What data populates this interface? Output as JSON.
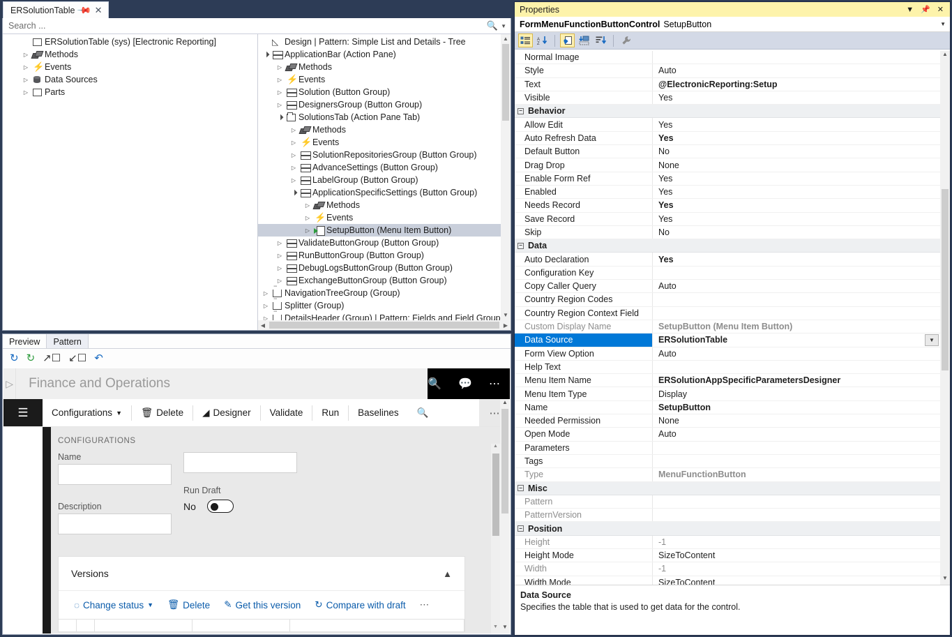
{
  "window": {
    "background": "#2d3c56"
  },
  "document_tab": {
    "label": "ERSolutionTable",
    "pin_icon": "pin-icon",
    "close_icon": "close-icon"
  },
  "search": {
    "placeholder": "Search ...",
    "icon": "search-icon",
    "dropdown_icon": "chevron-down-icon"
  },
  "model_tree": {
    "nodes": [
      {
        "label": "ERSolutionTable (sys) [Electronic Reporting]",
        "icon": "form-icon",
        "indent": 1,
        "arrow": "none"
      },
      {
        "label": "Methods",
        "icon": "methods-icon",
        "indent": 1,
        "arrow": "closed"
      },
      {
        "label": "Events",
        "icon": "event-icon",
        "indent": 1,
        "arrow": "closed"
      },
      {
        "label": "Data Sources",
        "icon": "datasource-icon",
        "indent": 1,
        "arrow": "closed"
      },
      {
        "label": "Parts",
        "icon": "form-icon",
        "indent": 1,
        "arrow": "closed"
      }
    ]
  },
  "design_tree": {
    "nodes": [
      {
        "label": "Design | Pattern: Simple List and Details - Tree",
        "icon": "design-icon",
        "indent": 0,
        "arrow": "none",
        "selected": false
      },
      {
        "label": "ApplicationBar (Action Pane)",
        "icon": "btngroup-icon",
        "indent": 0,
        "arrow": "open",
        "selected": false
      },
      {
        "label": "Methods",
        "icon": "methods-icon",
        "indent": 1,
        "arrow": "closed",
        "selected": false
      },
      {
        "label": "Events",
        "icon": "event-icon",
        "indent": 1,
        "arrow": "closed",
        "selected": false
      },
      {
        "label": "Solution (Button Group)",
        "icon": "btngroup-icon",
        "indent": 1,
        "arrow": "closed",
        "selected": false
      },
      {
        "label": "DesignersGroup (Button Group)",
        "icon": "btngroup-icon",
        "indent": 1,
        "arrow": "closed",
        "selected": false
      },
      {
        "label": "SolutionsTab (Action Pane Tab)",
        "icon": "tab-icon",
        "indent": 1,
        "arrow": "open",
        "selected": false
      },
      {
        "label": "Methods",
        "icon": "methods-icon",
        "indent": 2,
        "arrow": "closed",
        "selected": false
      },
      {
        "label": "Events",
        "icon": "event-icon",
        "indent": 2,
        "arrow": "closed",
        "selected": false
      },
      {
        "label": "SolutionRepositoriesGroup (Button Group)",
        "icon": "btngroup-icon",
        "indent": 2,
        "arrow": "closed",
        "selected": false
      },
      {
        "label": "AdvanceSettings (Button Group)",
        "icon": "btngroup-icon",
        "indent": 2,
        "arrow": "closed",
        "selected": false
      },
      {
        "label": "LabelGroup (Button Group)",
        "icon": "btngroup-icon",
        "indent": 2,
        "arrow": "closed",
        "selected": false
      },
      {
        "label": "ApplicationSpecificSettings (Button Group)",
        "icon": "btngroup-icon",
        "indent": 2,
        "arrow": "open",
        "selected": false
      },
      {
        "label": "Methods",
        "icon": "methods-icon",
        "indent": 3,
        "arrow": "closed",
        "selected": false
      },
      {
        "label": "Events",
        "icon": "event-icon",
        "indent": 3,
        "arrow": "closed",
        "selected": false
      },
      {
        "label": "SetupButton (Menu Item Button)",
        "icon": "menuitem-icon",
        "indent": 3,
        "arrow": "closed",
        "selected": true
      },
      {
        "label": "ValidateButtonGroup (Button Group)",
        "icon": "btngroup-icon",
        "indent": 1,
        "arrow": "closed",
        "selected": false
      },
      {
        "label": "RunButtonGroup (Button Group)",
        "icon": "btngroup-icon",
        "indent": 1,
        "arrow": "closed",
        "selected": false
      },
      {
        "label": "DebugLogsButtonGroup (Button Group)",
        "icon": "btngroup-icon",
        "indent": 1,
        "arrow": "closed",
        "selected": false
      },
      {
        "label": "ExchangeButtonGroup (Button Group)",
        "icon": "btngroup-icon",
        "indent": 1,
        "arrow": "closed",
        "selected": false
      },
      {
        "label": "NavigationTreeGroup (Group)",
        "icon": "group-icon",
        "indent": 0,
        "arrow": "closed",
        "selected": false
      },
      {
        "label": "Splitter (Group)",
        "icon": "group-icon",
        "indent": 0,
        "arrow": "closed",
        "selected": false
      },
      {
        "label": "DetailsHeader (Group) | Pattern: Fields and Field Groups",
        "icon": "group-icon",
        "indent": 0,
        "arrow": "closed",
        "selected": false
      }
    ]
  },
  "preview_pane": {
    "tabs": [
      {
        "label": "Preview",
        "active": true
      },
      {
        "label": "Pattern",
        "active": false
      }
    ],
    "toolbar": [
      {
        "icon": "refresh-icon",
        "color": "#1669c1"
      },
      {
        "icon": "refresh-green-icon",
        "color": "#2e9b3e"
      },
      {
        "icon": "open-external-icon",
        "color": "#333333"
      },
      {
        "icon": "collapse-icon",
        "color": "#333333"
      },
      {
        "icon": "undo-icon",
        "color": "#1669c1"
      }
    ]
  },
  "fo_preview": {
    "play_icon": "play-icon",
    "brand": "Finance and Operations",
    "header_icons": [
      "search-icon",
      "feedback-icon",
      "ellipsis-icon"
    ],
    "hamburger_icon": "hamburger-icon",
    "action_items": [
      {
        "label": "Configurations",
        "icon": "chevron-down-icon"
      },
      {
        "label": "Delete",
        "icon": "trash-icon"
      },
      {
        "label": "Designer",
        "icon": "designer-icon"
      },
      {
        "label": "Validate",
        "icon": ""
      },
      {
        "label": "Run",
        "icon": ""
      },
      {
        "label": "Baselines",
        "icon": ""
      },
      {
        "label": "",
        "icon": "search-icon"
      }
    ],
    "overflow_icon": "ellipsis-icon",
    "section_title": "CONFIGURATIONS",
    "fields": [
      {
        "label": "Name",
        "value": ""
      },
      {
        "label": "Description",
        "value": ""
      }
    ],
    "run_draft": {
      "label": "Run Draft",
      "value": "No"
    },
    "versions_card": {
      "title": "Versions",
      "collapse_icon": "chevron-up-icon",
      "actions": [
        {
          "label": "Change status",
          "icon": "status-icon",
          "caret": "chevron-down-icon"
        },
        {
          "label": "Delete",
          "icon": "trash-icon",
          "caret": ""
        },
        {
          "label": "Get this version",
          "icon": "edit-icon",
          "caret": ""
        },
        {
          "label": "Compare with draft",
          "icon": "compare-icon",
          "caret": ""
        },
        {
          "label": "",
          "icon": "ellipsis-icon",
          "caret": ""
        }
      ]
    }
  },
  "properties": {
    "title": "Properties",
    "title_icons": [
      "chevron-down-icon",
      "pin-icon",
      "close-icon"
    ],
    "object_type": "FormMenuFunctionButtonControl",
    "object_name": "SetupButton",
    "dropdown_icon": "chevron-down-icon",
    "toolbar": [
      {
        "icon": "categorized-icon",
        "active": true
      },
      {
        "icon": "alphabetical-sort-icon",
        "active": false
      },
      {
        "icon": "properties-page-icon",
        "active": true
      },
      {
        "icon": "property-pages-icon",
        "active": false
      },
      {
        "icon": "events-icon",
        "active": false
      },
      {
        "icon": "wrench-icon",
        "active": false
      }
    ],
    "selection_color": "#0078d7",
    "rows": [
      {
        "kind": "prop",
        "key": "Normal Image",
        "value": "",
        "bold": false,
        "dim": false
      },
      {
        "kind": "prop",
        "key": "Style",
        "value": "Auto",
        "bold": false,
        "dim": false
      },
      {
        "kind": "prop",
        "key": "Text",
        "value": "@ElectronicReporting:Setup",
        "bold": true,
        "dim": false
      },
      {
        "kind": "prop",
        "key": "Visible",
        "value": "Yes",
        "bold": false,
        "dim": false
      },
      {
        "kind": "cat",
        "key": "Behavior",
        "value": "",
        "bold": true,
        "dim": false
      },
      {
        "kind": "prop",
        "key": "Allow Edit",
        "value": "Yes",
        "bold": false,
        "dim": false
      },
      {
        "kind": "prop",
        "key": "Auto Refresh Data",
        "value": "Yes",
        "bold": true,
        "dim": false
      },
      {
        "kind": "prop",
        "key": "Default Button",
        "value": "No",
        "bold": false,
        "dim": false
      },
      {
        "kind": "prop",
        "key": "Drag Drop",
        "value": "None",
        "bold": false,
        "dim": false
      },
      {
        "kind": "prop",
        "key": "Enable Form Ref",
        "value": "Yes",
        "bold": false,
        "dim": false
      },
      {
        "kind": "prop",
        "key": "Enabled",
        "value": "Yes",
        "bold": false,
        "dim": false
      },
      {
        "kind": "prop",
        "key": "Needs Record",
        "value": "Yes",
        "bold": true,
        "dim": false
      },
      {
        "kind": "prop",
        "key": "Save Record",
        "value": "Yes",
        "bold": false,
        "dim": false
      },
      {
        "kind": "prop",
        "key": "Skip",
        "value": "No",
        "bold": false,
        "dim": false
      },
      {
        "kind": "cat",
        "key": "Data",
        "value": "",
        "bold": true,
        "dim": false
      },
      {
        "kind": "prop",
        "key": "Auto Declaration",
        "value": "Yes",
        "bold": true,
        "dim": false
      },
      {
        "kind": "prop",
        "key": "Configuration Key",
        "value": "",
        "bold": false,
        "dim": false
      },
      {
        "kind": "prop",
        "key": "Copy Caller Query",
        "value": "Auto",
        "bold": false,
        "dim": false
      },
      {
        "kind": "prop",
        "key": "Country Region Codes",
        "value": "",
        "bold": false,
        "dim": false
      },
      {
        "kind": "prop",
        "key": "Country Region Context Field",
        "value": "",
        "bold": false,
        "dim": false
      },
      {
        "kind": "prop",
        "key": "Custom Display Name",
        "value": "SetupButton (Menu Item Button)",
        "bold": true,
        "dim": true
      },
      {
        "kind": "selected",
        "key": "Data Source",
        "value": "ERSolutionTable",
        "bold": true,
        "dim": false
      },
      {
        "kind": "prop",
        "key": "Form View Option",
        "value": "Auto",
        "bold": false,
        "dim": false
      },
      {
        "kind": "prop",
        "key": "Help Text",
        "value": "",
        "bold": false,
        "dim": false
      },
      {
        "kind": "prop",
        "key": "Menu Item Name",
        "value": "ERSolutionAppSpecificParametersDesigner",
        "bold": true,
        "dim": false
      },
      {
        "kind": "prop",
        "key": "Menu Item Type",
        "value": "Display",
        "bold": false,
        "dim": false
      },
      {
        "kind": "prop",
        "key": "Name",
        "value": "SetupButton",
        "bold": true,
        "dim": false
      },
      {
        "kind": "prop",
        "key": "Needed Permission",
        "value": "None",
        "bold": false,
        "dim": false
      },
      {
        "kind": "prop",
        "key": "Open Mode",
        "value": "Auto",
        "bold": false,
        "dim": false
      },
      {
        "kind": "prop",
        "key": "Parameters",
        "value": "",
        "bold": false,
        "dim": false
      },
      {
        "kind": "prop",
        "key": "Tags",
        "value": "",
        "bold": false,
        "dim": false
      },
      {
        "kind": "prop",
        "key": "Type",
        "value": "MenuFunctionButton",
        "bold": true,
        "dim": true
      },
      {
        "kind": "cat",
        "key": "Misc",
        "value": "",
        "bold": true,
        "dim": false
      },
      {
        "kind": "prop",
        "key": "Pattern",
        "value": "",
        "bold": false,
        "dim": true
      },
      {
        "kind": "prop",
        "key": "PatternVersion",
        "value": "",
        "bold": false,
        "dim": true
      },
      {
        "kind": "cat",
        "key": "Position",
        "value": "",
        "bold": true,
        "dim": false
      },
      {
        "kind": "prop",
        "key": "Height",
        "value": "-1",
        "bold": false,
        "dim": true
      },
      {
        "kind": "prop",
        "key": "Height Mode",
        "value": "SizeToContent",
        "bold": false,
        "dim": false
      },
      {
        "kind": "prop",
        "key": "Width",
        "value": "-1",
        "bold": false,
        "dim": true
      },
      {
        "kind": "prop",
        "key": "Width Mode",
        "value": "SizeToContent",
        "bold": false,
        "dim": false
      }
    ],
    "description": {
      "heading": "Data Source",
      "text": "Specifies the table that is used to get data for the control."
    }
  }
}
